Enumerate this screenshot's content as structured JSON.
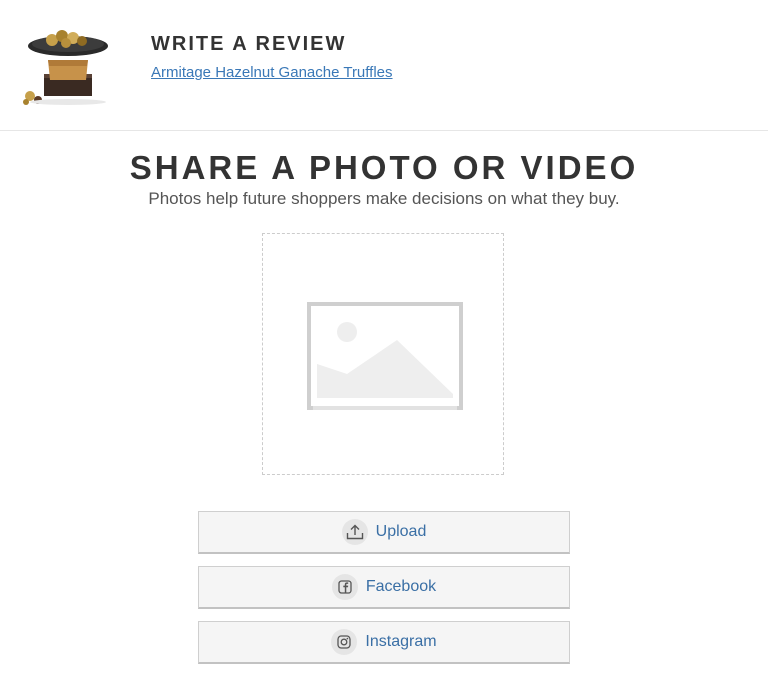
{
  "header": {
    "title": "WRITE A REVIEW",
    "product_link": "Armitage Hazelnut Ganache Truffles"
  },
  "section": {
    "title": "SHARE A PHOTO OR VIDEO",
    "subtitle": "Photos help future shoppers make decisions on what they buy."
  },
  "buttons": {
    "upload": {
      "label": "Upload",
      "icon": "upload-icon"
    },
    "facebook": {
      "label": "Facebook",
      "icon": "facebook-icon"
    },
    "instagram": {
      "label": "Instagram",
      "icon": "instagram-icon"
    }
  },
  "colors": {
    "link": "#3a78b7",
    "button_text": "#3a6fa5",
    "button_bg": "#f5f5f5",
    "dropzone_border": "#cccccc"
  }
}
